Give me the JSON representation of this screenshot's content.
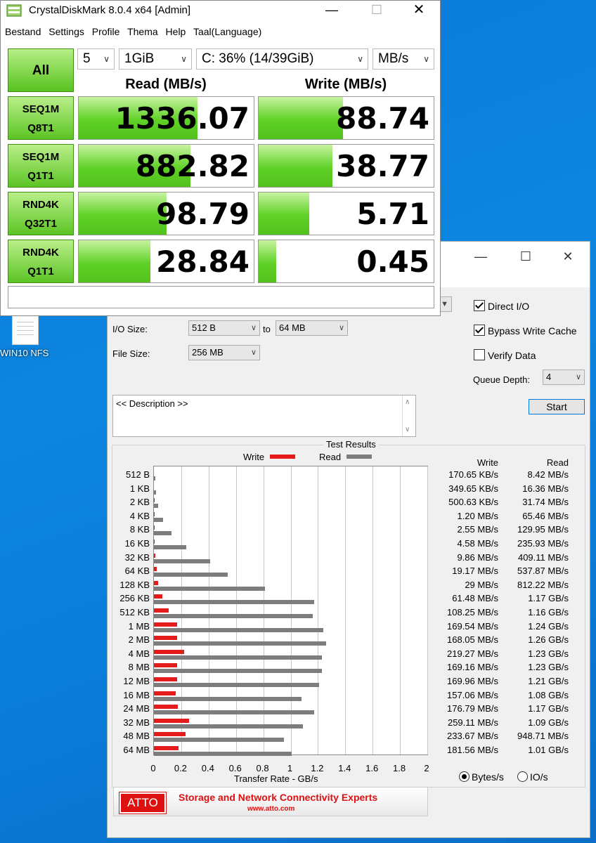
{
  "desktop": {
    "icon_label": "WIN10 NFS"
  },
  "cdm": {
    "title": "CrystalDiskMark 8.0.4 x64 [Admin]",
    "menu": [
      "Bestand",
      "Settings",
      "Profile",
      "Thema",
      "Help",
      "Taal(Language)"
    ],
    "count": "5",
    "size": "1GiB",
    "drive": "C: 36% (14/39GiB)",
    "unit": "MB/s",
    "all_label": "All",
    "read_header": "Read (MB/s)",
    "write_header": "Write (MB/s)",
    "tests": [
      {
        "line1": "SEQ1M",
        "line2": "Q8T1",
        "read": "1336.07",
        "write": "88.74",
        "read_fill": 0.68,
        "write_fill": 0.48
      },
      {
        "line1": "SEQ1M",
        "line2": "Q1T1",
        "read": "882.82",
        "write": "38.77",
        "read_fill": 0.64,
        "write_fill": 0.42
      },
      {
        "line1": "RND4K",
        "line2": "Q32T1",
        "read": "98.79",
        "write": "5.71",
        "read_fill": 0.5,
        "write_fill": 0.29
      },
      {
        "line1": "RND4K",
        "line2": "Q1T1",
        "read": "28.84",
        "write": "0.45",
        "read_fill": 0.41,
        "write_fill": 0.1
      }
    ],
    "comment": ""
  },
  "atto": {
    "io_size_label": "I/O Size:",
    "io_from": "512 B",
    "to_label": "to",
    "io_to": "64 MB",
    "file_size_label": "File Size:",
    "file_size": "256 MB",
    "direct_io": "Direct I/O",
    "bypass_cache": "Bypass Write Cache",
    "verify_data": "Verify Data",
    "queue_depth_label": "Queue Depth:",
    "queue_depth": "4",
    "start": "Start",
    "description": "<< Description >>",
    "results_title": "Test Results",
    "legend_write": "Write",
    "legend_read": "Read",
    "col_write": "Write",
    "col_read": "Read",
    "xlabel": "Transfer Rate - GB/s",
    "radio_bytes": "Bytes/s",
    "radio_io": "IO/s",
    "banner_slogan": "Storage and Network Connectivity Experts",
    "banner_url": "www.atto.com",
    "banner_logo": "ATTO",
    "colors": {
      "write": "#e51a1a",
      "read": "#7d7d7d"
    }
  },
  "chart_data": {
    "type": "bar",
    "orientation": "horizontal",
    "categories": [
      "512 B",
      "1 KB",
      "2 KB",
      "4 KB",
      "8 KB",
      "16 KB",
      "32 KB",
      "64 KB",
      "128 KB",
      "256 KB",
      "512 KB",
      "1 MB",
      "2 MB",
      "4 MB",
      "8 MB",
      "12 MB",
      "16 MB",
      "24 MB",
      "32 MB",
      "48 MB",
      "64 MB"
    ],
    "series": [
      {
        "name": "Write",
        "values": [
          0.00017,
          0.00035,
          0.0005,
          0.0012,
          0.00255,
          0.00458,
          0.00986,
          0.01917,
          0.029,
          0.06148,
          0.10825,
          0.16954,
          0.16805,
          0.21927,
          0.16916,
          0.16996,
          0.15706,
          0.17679,
          0.25911,
          0.23367,
          0.18156
        ]
      },
      {
        "name": "Read",
        "values": [
          0.00842,
          0.01636,
          0.03174,
          0.06546,
          0.12995,
          0.23593,
          0.40911,
          0.53787,
          0.81222,
          1.17,
          1.16,
          1.24,
          1.26,
          1.23,
          1.23,
          1.21,
          1.08,
          1.17,
          1.09,
          0.94871,
          1.01
        ]
      }
    ],
    "write_text": [
      "170.65 KB/s",
      "349.65 KB/s",
      "500.63 KB/s",
      "1.20 MB/s",
      "2.55 MB/s",
      "4.58 MB/s",
      "9.86 MB/s",
      "19.17 MB/s",
      "29 MB/s",
      "61.48 MB/s",
      "108.25 MB/s",
      "169.54 MB/s",
      "168.05 MB/s",
      "219.27 MB/s",
      "169.16 MB/s",
      "169.96 MB/s",
      "157.06 MB/s",
      "176.79 MB/s",
      "259.11 MB/s",
      "233.67 MB/s",
      "181.56 MB/s"
    ],
    "read_text": [
      "8.42 MB/s",
      "16.36 MB/s",
      "31.74 MB/s",
      "65.46 MB/s",
      "129.95 MB/s",
      "235.93 MB/s",
      "409.11 MB/s",
      "537.87 MB/s",
      "812.22 MB/s",
      "1.17 GB/s",
      "1.16 GB/s",
      "1.24 GB/s",
      "1.26 GB/s",
      "1.23 GB/s",
      "1.23 GB/s",
      "1.21 GB/s",
      "1.08 GB/s",
      "1.17 GB/s",
      "1.09 GB/s",
      "948.71 MB/s",
      "1.01 GB/s"
    ],
    "xticks": [
      "0",
      "0.2",
      "0.4",
      "0.6",
      "0.8",
      "1",
      "1.2",
      "1.4",
      "1.6",
      "1.8",
      "2"
    ],
    "xlim": [
      0,
      2
    ],
    "xlabel": "Transfer Rate - GB/s",
    "legend": "top-center",
    "grid": true
  }
}
